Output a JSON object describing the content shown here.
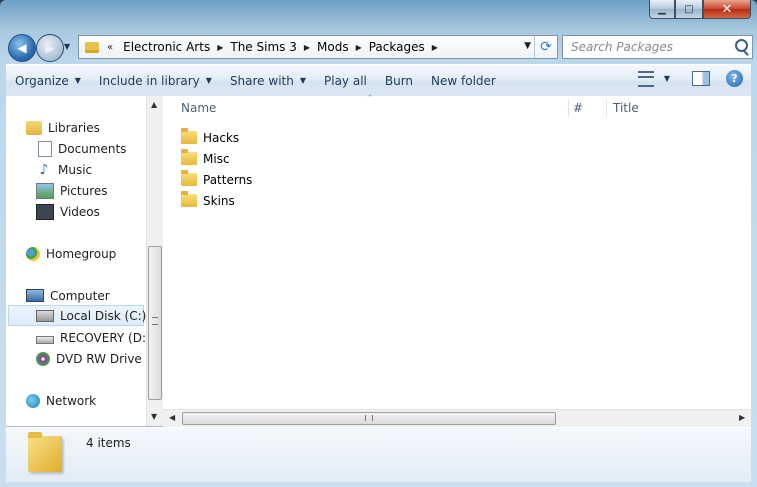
{
  "window": {
    "caption_buttons": {
      "minimize": "▁",
      "maximize": "□",
      "close": "✕"
    }
  },
  "navigation": {
    "back_glyph": "◀",
    "forward_glyph": "▶",
    "overflow_chevron": "«",
    "breadcrumbs": [
      "Electronic Arts",
      "The Sims 3",
      "Mods",
      "Packages"
    ],
    "crumb_separator": "▶",
    "dropdown_glyph": "▼",
    "refresh_glyph": "⟳"
  },
  "search": {
    "placeholder": "Search Packages"
  },
  "toolbar": {
    "items": [
      "Organize",
      "Include in library",
      "Share with",
      "Play all",
      "Burn",
      "New folder"
    ],
    "caret": "▼",
    "help_glyph": "?"
  },
  "nav_pane": {
    "libraries": "Libraries",
    "documents": "Documents",
    "music": "Music",
    "pictures": "Pictures",
    "videos": "Videos",
    "homegroup": "Homegroup",
    "computer": "Computer",
    "local_disk": "Local Disk (C:)",
    "recovery": "RECOVERY (D:)",
    "dvd": "DVD RW Drive (E",
    "network": "Network",
    "selected": "Local Disk (C:)",
    "scroll_up": "▲",
    "scroll_down": "▼"
  },
  "columns": {
    "name": "Name",
    "number": "#",
    "title": "Title",
    "sort_glyph": "^"
  },
  "files": [
    "Hacks",
    "Misc",
    "Patterns",
    "Skins"
  ],
  "hscroll": {
    "left": "◀",
    "right": "▶"
  },
  "status": {
    "count": "4 items"
  },
  "icons": {
    "back": "back-arrow-icon",
    "forward": "forward-arrow-icon",
    "folder": "folder-icon",
    "search": "search-icon",
    "refresh": "refresh-icon",
    "views": "views-icon",
    "preview_pane": "preview-pane-icon",
    "help": "help-icon"
  },
  "colors": {
    "accent": "#1e395b",
    "selection": "#dcebfc",
    "folder": "#e7b93b"
  }
}
